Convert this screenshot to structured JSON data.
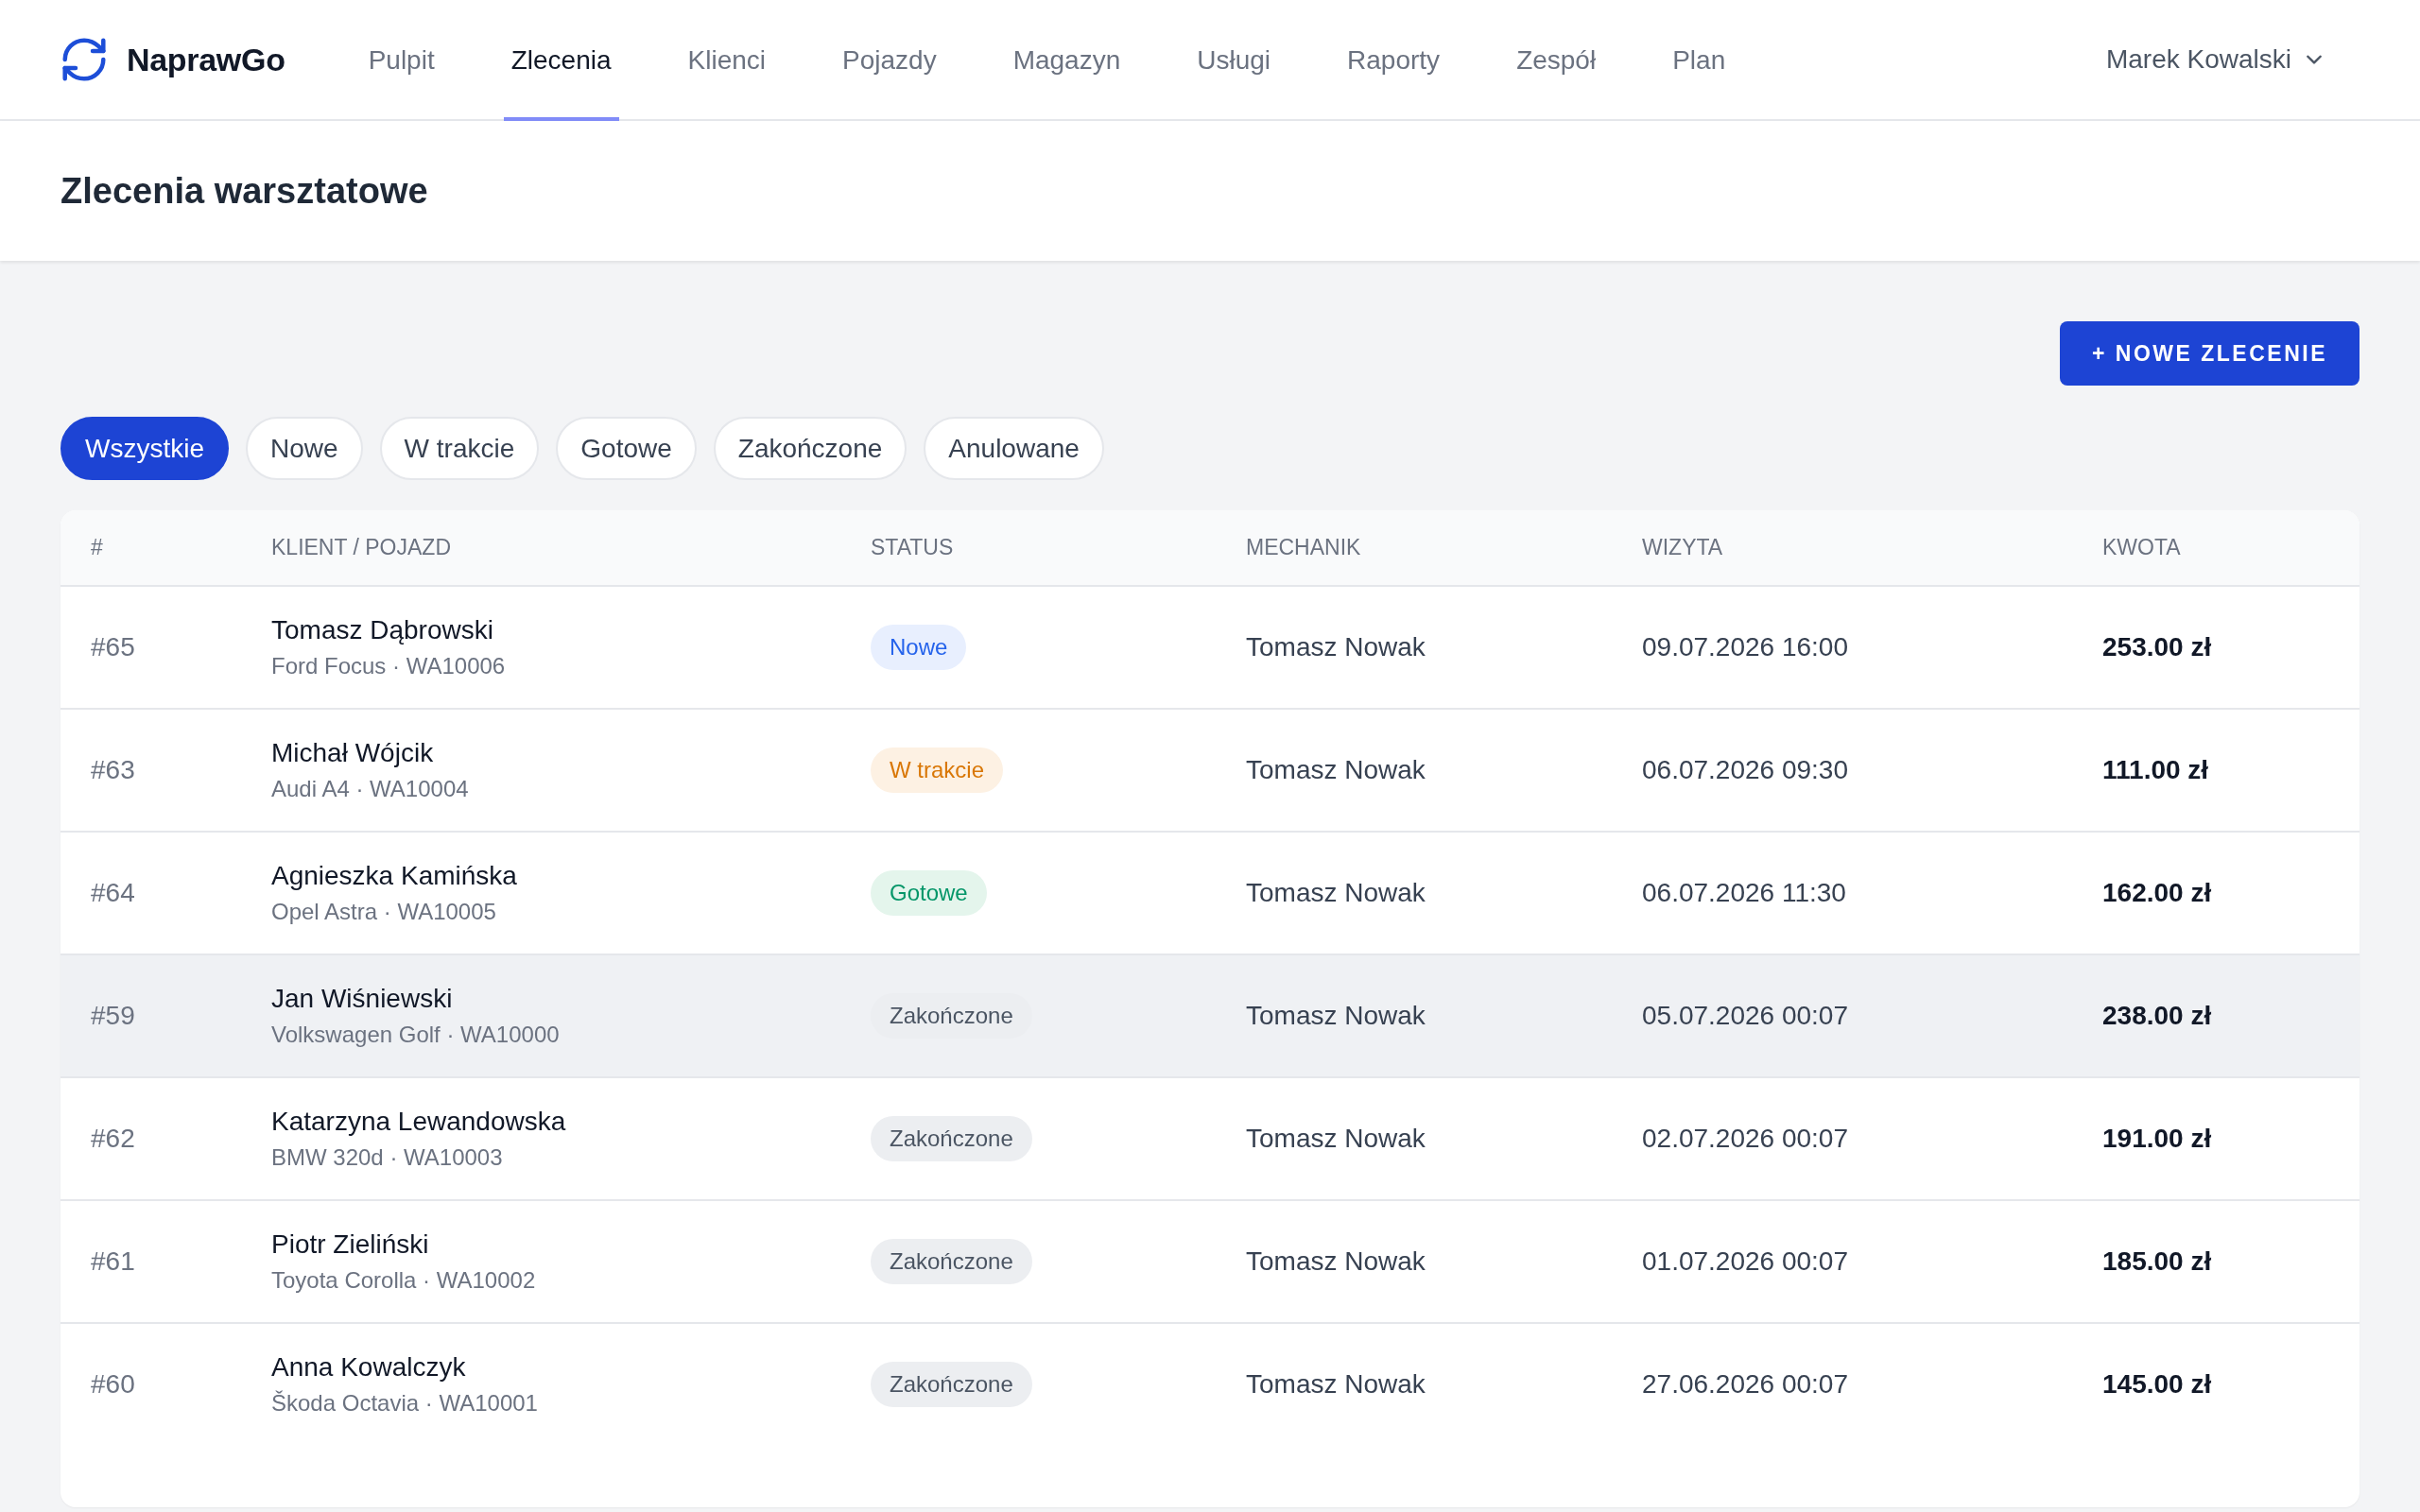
{
  "app": {
    "brand": "NaprawGo"
  },
  "nav": [
    {
      "label": "Pulpit",
      "selected": false
    },
    {
      "label": "Zlecenia",
      "selected": true
    },
    {
      "label": "Klienci",
      "selected": false
    },
    {
      "label": "Pojazdy",
      "selected": false
    },
    {
      "label": "Magazyn",
      "selected": false
    },
    {
      "label": "Usługi",
      "selected": false
    },
    {
      "label": "Raporty",
      "selected": false
    },
    {
      "label": "Zespół",
      "selected": false
    },
    {
      "label": "Plan",
      "selected": false
    }
  ],
  "user_menu": {
    "name": "Marek Kowalski"
  },
  "page_title": "Zlecenia warsztatowe",
  "new_order_button": "+ NOWE ZLECENIE",
  "filters": [
    {
      "label": "Wszystkie",
      "selected": true
    },
    {
      "label": "Nowe",
      "selected": false
    },
    {
      "label": "W trakcie",
      "selected": false
    },
    {
      "label": "Gotowe",
      "selected": false
    },
    {
      "label": "Zakończone",
      "selected": false
    },
    {
      "label": "Anulowane",
      "selected": false
    }
  ],
  "table": {
    "columns": [
      "#",
      "KLIENT / POJAZD",
      "STATUS",
      "MECHANIK",
      "WIZYTA",
      "KWOTA"
    ],
    "rows": [
      {
        "number": "#65",
        "client": "Tomasz Dąbrowski",
        "vehicle": "Ford Focus · WA10006",
        "status": {
          "label": "Nowe",
          "kind": "new"
        },
        "mechanic": "Tomasz Nowak",
        "visit": "09.07.2026 16:00",
        "amount": "253.00 zł",
        "highlighted": false
      },
      {
        "number": "#63",
        "client": "Michał Wójcik",
        "vehicle": "Audi A4 · WA10004",
        "status": {
          "label": "W trakcie",
          "kind": "progress"
        },
        "mechanic": "Tomasz Nowak",
        "visit": "06.07.2026 09:30",
        "amount": "111.00 zł",
        "highlighted": false
      },
      {
        "number": "#64",
        "client": "Agnieszka Kamińska",
        "vehicle": "Opel Astra · WA10005",
        "status": {
          "label": "Gotowe",
          "kind": "ready"
        },
        "mechanic": "Tomasz Nowak",
        "visit": "06.07.2026 11:30",
        "amount": "162.00 zł",
        "highlighted": false
      },
      {
        "number": "#59",
        "client": "Jan Wiśniewski",
        "vehicle": "Volkswagen Golf · WA10000",
        "status": {
          "label": "Zakończone",
          "kind": "done"
        },
        "mechanic": "Tomasz Nowak",
        "visit": "05.07.2026 00:07",
        "amount": "238.00 zł",
        "highlighted": true
      },
      {
        "number": "#62",
        "client": "Katarzyna Lewandowska",
        "vehicle": "BMW 320d · WA10003",
        "status": {
          "label": "Zakończone",
          "kind": "done"
        },
        "mechanic": "Tomasz Nowak",
        "visit": "02.07.2026 00:07",
        "amount": "191.00 zł",
        "highlighted": false
      },
      {
        "number": "#61",
        "client": "Piotr Zieliński",
        "vehicle": "Toyota Corolla · WA10002",
        "status": {
          "label": "Zakończone",
          "kind": "done"
        },
        "mechanic": "Tomasz Nowak",
        "visit": "01.07.2026 00:07",
        "amount": "185.00 zł",
        "highlighted": false
      },
      {
        "number": "#60",
        "client": "Anna Kowalczyk",
        "vehicle": "Škoda Octavia · WA10001",
        "status": {
          "label": "Zakończone",
          "kind": "done"
        },
        "mechanic": "Tomasz Nowak",
        "visit": "27.06.2026 00:07",
        "amount": "145.00 zł",
        "highlighted": false
      }
    ]
  }
}
